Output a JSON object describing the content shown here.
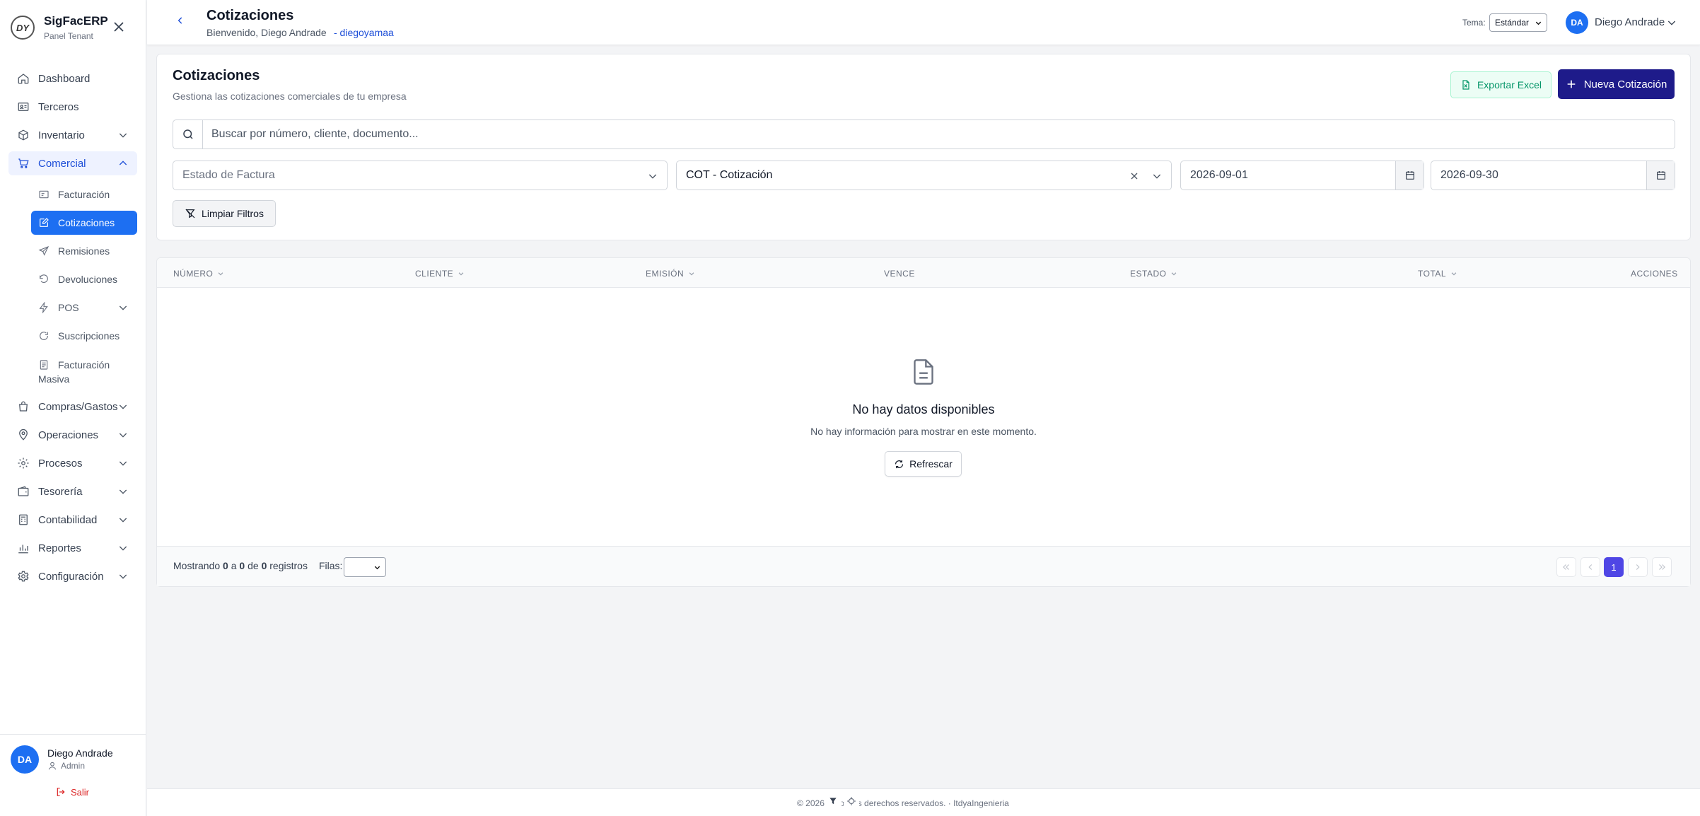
{
  "app": {
    "brand": "SigFacERP",
    "subtitle": "Panel Tenant",
    "logo_text": "DY"
  },
  "sidebar": {
    "items": [
      {
        "label": "Dashboard",
        "icon": "home-icon"
      },
      {
        "label": "Terceros",
        "icon": "id-card-icon"
      },
      {
        "label": "Inventario",
        "icon": "box-icon"
      },
      {
        "label": "Comercial",
        "icon": "cart-icon"
      }
    ],
    "comercial_sub": [
      {
        "label": "Facturación",
        "icon": "receipt-icon"
      },
      {
        "label": "Cotizaciones",
        "icon": "edit-icon"
      },
      {
        "label": "Remisiones",
        "icon": "send-icon"
      },
      {
        "label": "Devoluciones",
        "icon": "undo-icon"
      },
      {
        "label": "POS",
        "icon": "bolt-icon"
      },
      {
        "label": "Suscripciones",
        "icon": "refresh-icon"
      },
      {
        "label_line1": "Facturación",
        "label_line2": "Masiva",
        "icon": "document-icon"
      }
    ],
    "items_after": [
      {
        "label": "Compras/Gastos",
        "icon": "bag-icon"
      },
      {
        "label": "Operaciones",
        "icon": "pin-icon"
      },
      {
        "label": "Procesos",
        "icon": "gear-icon"
      },
      {
        "label": "Tesorería",
        "icon": "wallet-icon"
      },
      {
        "label": "Contabilidad",
        "icon": "calculator-icon"
      },
      {
        "label": "Reportes",
        "icon": "bar-chart-icon"
      },
      {
        "label": "Configuración",
        "icon": "settings-icon"
      }
    ],
    "user": {
      "initials": "DA",
      "name": "Diego Andrade",
      "role": "Admin",
      "logout": "Salir"
    }
  },
  "header": {
    "title": "Cotizaciones",
    "welcome": "Bienvenido, Diego Andrade",
    "tenant": "- diegoyamaa",
    "theme_label": "Tema:",
    "theme_value": "Estándar",
    "user_initials": "DA",
    "user_name": "Diego Andrade"
  },
  "page": {
    "title": "Cotizaciones",
    "subtitle": "Gestiona las cotizaciones comerciales de tu empresa",
    "export_label": "Exportar Excel",
    "new_label": "Nueva Cotización",
    "search_placeholder": "Buscar por número, cliente, documento...",
    "filters": {
      "estado_placeholder": "Estado de Factura",
      "tipo_value": "COT - Cotización",
      "date_from": "2026-09-01",
      "date_to": "2026-09-30",
      "clear_label": "Limpiar Filtros"
    }
  },
  "table": {
    "columns": [
      "NÚMERO",
      "CLIENTE",
      "EMISIÓN",
      "VENCE",
      "ESTADO",
      "TOTAL",
      "ACCIONES"
    ],
    "empty_title": "No hay datos disponibles",
    "empty_text": "No hay información para mostrar en este momento.",
    "refresh_label": "Refrescar",
    "summary_prefix": "Mostrando",
    "summary_from": "0",
    "summary_a": "a",
    "summary_to": "0",
    "summary_de": "de",
    "summary_total": "0",
    "summary_suffix": "registros",
    "rows_label": "Filas:",
    "current_page": "1"
  },
  "footer": {
    "text_left": "© 2026",
    "text_right": "odos los derechos reservados. · ItdyaIngenieria"
  },
  "colors": {
    "primary": "#1d6ff2",
    "navy": "#1e1b8a",
    "page_active": "#4f46e5"
  }
}
